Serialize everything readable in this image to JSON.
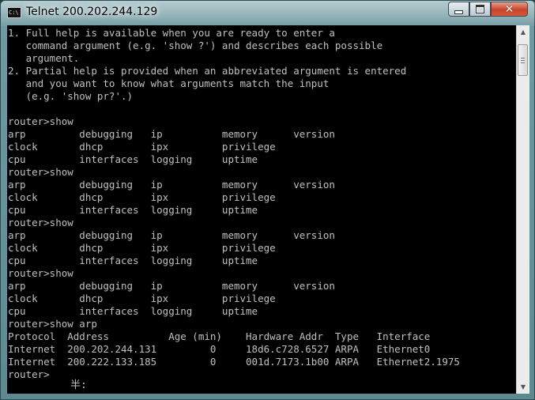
{
  "window": {
    "icon_text": "C:\\",
    "title": "Telnet 200.202.244.129",
    "close_glyph": "✕"
  },
  "console": {
    "lines": [
      "1. Full help is available when you are ready to enter a",
      "   command argument (e.g. 'show ?') and describes each possible",
      "   argument.",
      "2. Partial help is provided when an abbreviated argument is entered",
      "   and you want to know what arguments match the input",
      "   (e.g. 'show pr?'.)",
      "",
      "router>show",
      "arp         debugging   ip          memory      version",
      "clock       dhcp        ipx         privilege",
      "cpu         interfaces  logging     uptime",
      "router>show",
      "arp         debugging   ip          memory      version",
      "clock       dhcp        ipx         privilege",
      "cpu         interfaces  logging     uptime",
      "router>show",
      "arp         debugging   ip          memory      version",
      "clock       dhcp        ipx         privilege",
      "cpu         interfaces  logging     uptime",
      "router>show",
      "arp         debugging   ip          memory      version",
      "clock       dhcp        ipx         privilege",
      "cpu         interfaces  logging     uptime",
      "router>show arp",
      "Protocol  Address          Age (min)    Hardware Addr  Type   Interface",
      "Internet  200.202.244.131         0     18d6.c728.6527 ARPA   Ethernet0",
      "Internet  200.222.133.185         0     001d.7173.1b00 ARPA   Ethernet2.1975",
      "router>"
    ],
    "ime_indicator": "半:"
  },
  "scrollbar": {
    "up_arrow": "▲",
    "down_arrow": "▼"
  }
}
